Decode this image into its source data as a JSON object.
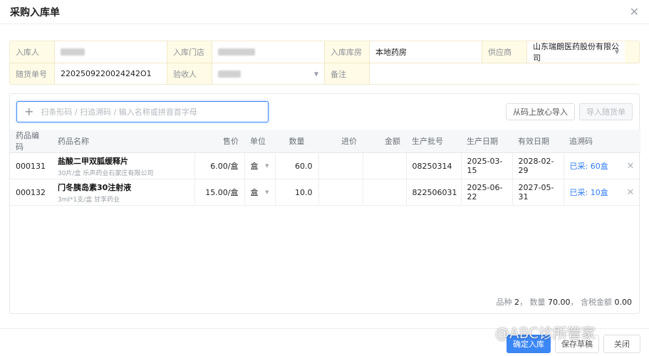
{
  "window": {
    "title": "采购入库单"
  },
  "form": {
    "row1": [
      {
        "label": "入库人",
        "value": "",
        "blurred": true
      },
      {
        "label": "入库门店",
        "value": "",
        "blurred": true
      },
      {
        "label": "入库库房",
        "value": "本地药房"
      },
      {
        "label": "供应商",
        "value": "山东瑞朗医药股份有限公司",
        "dropdown": true
      }
    ],
    "row2": [
      {
        "label": "随货单号",
        "value": "2202509220024242O1"
      },
      {
        "label": "验收人",
        "value": "",
        "blurred": true,
        "dropdown": true
      },
      {
        "label": "备注",
        "value": ""
      }
    ]
  },
  "toolbar": {
    "search_placeholder": "扫条形码 / 扫追溯码 / 输入名称或拼音首字母",
    "import_button": "从码上放心导入",
    "import_invoice_button": "导入随货单"
  },
  "table": {
    "headers": [
      "药品编码",
      "药品名称",
      "售价",
      "单位",
      "数量",
      "进价",
      "金额",
      "生产批号",
      "生产日期",
      "有效日期",
      "追溯码"
    ],
    "rows": [
      {
        "code": "000131",
        "name": "盐酸二甲双胍缓释片",
        "spec": "30片/盒 乐声药业石家庄有限公司",
        "price": "6.00/盒",
        "unit": "盒",
        "qty": "60.0",
        "cost": "",
        "amount": "",
        "batch": "08250314",
        "mfg_date": "2025-03-15",
        "exp_date": "2028-02-29",
        "trace": "已采: 60盒"
      },
      {
        "code": "000132",
        "name": "门冬胰岛素30注射液",
        "spec": "3ml*1支/盒 甘李药业",
        "price": "15.00/盒",
        "unit": "盒",
        "qty": "10.0",
        "cost": "",
        "amount": "",
        "batch": "822506031",
        "mfg_date": "2025-06-22",
        "exp_date": "2027-05-31",
        "trace": "已采: 10盒"
      }
    ]
  },
  "summary": {
    "kinds_label": "品种",
    "kinds": "2",
    "qty_label": "数量",
    "qty": "70.00",
    "tax_label": "含税金额",
    "tax": "0.00"
  },
  "footer": {
    "confirm": "确定入库",
    "save_draft": "保存草稿",
    "close": "关闭"
  },
  "watermark": "@ABC诊所管家",
  "colors": {
    "primary": "#3c87f6",
    "form_bg": "#fffbe6",
    "trace_link": "#2f7bf0"
  }
}
